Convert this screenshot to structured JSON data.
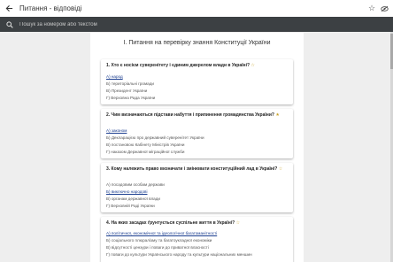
{
  "appbar": {
    "title": "Питання - відповіді",
    "back_icon": "arrow-left-icon",
    "star_icon": "star-outline-icon",
    "eye_icon": "eye-off-icon"
  },
  "search": {
    "placeholder": "Пошук за номером або текстом",
    "icon": "search-icon"
  },
  "section": {
    "title": "I. Питання на перевірку знання Конституції України"
  },
  "questions": [
    {
      "text": "1. Хто є носієм суверенітету і єдиним джерелом влади в Україні?",
      "star": "☆",
      "options": [
        "А) народ",
        "Б) територіальні громади",
        "В) Президент України",
        "Г) Верховна Рада України"
      ]
    },
    {
      "text": "2. Чим визначаються підстави набуття і припинення громадянства України?",
      "star": "★",
      "options": [
        "А) законом",
        "Б) Декларацією про державний суверенітет України",
        "В) постановою Кабінету Міністрів України",
        "Г) наказом Державної міграційної служби"
      ]
    },
    {
      "text": "3. Кому належить право визначати і змінювати конституційний лад в Україні?",
      "star": "☆",
      "options": [
        "А) посадовим особам держави",
        "Б) виключно народові",
        "В) органам державної влади",
        "Г) Верховній Раді України"
      ]
    },
    {
      "text": "4. На яких засадах ґрунтується суспільне життя в Україні?",
      "star": "☆",
      "options": [
        "А) політичної, економічної та ідеологічної багатоманітності",
        "Б) соціального плюралізму та багатоукладної економіки",
        "В) відсутності цензури і поваги до приватної власності",
        "Г) поваги до культури Українського народу та культури національних меншин"
      ]
    }
  ]
}
